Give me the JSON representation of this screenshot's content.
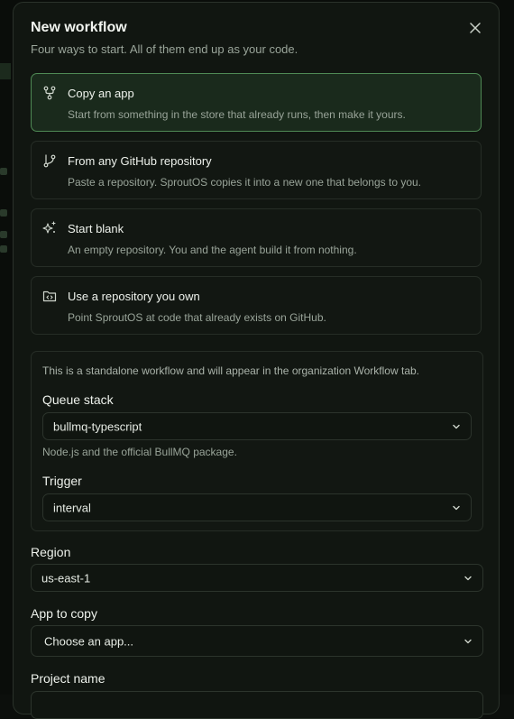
{
  "dialog": {
    "title": "New workflow",
    "subtitle": "Four ways to start. All of them end up as your code."
  },
  "options": [
    {
      "title": "Copy an app",
      "description": "Start from something in the store that already runs, then make it yours.",
      "icon": "fork-icon",
      "selected": true
    },
    {
      "title": "From any GitHub repository",
      "description": "Paste a repository. SproutOS copies it into a new one that belongs to you.",
      "icon": "git-branch-icon",
      "selected": false
    },
    {
      "title": "Start blank",
      "description": "An empty repository. You and the agent build it from nothing.",
      "icon": "sparkles-icon",
      "selected": false
    },
    {
      "title": "Use a repository you own",
      "description": "Point SproutOS at code that already exists on GitHub.",
      "icon": "folder-code-icon",
      "selected": false
    }
  ],
  "workflow_panel": {
    "note": "This is a standalone workflow and will appear in the organization Workflow tab.",
    "queue_stack": {
      "label": "Queue stack",
      "value": "bullmq-typescript",
      "hint": "Node.js and the official BullMQ package."
    },
    "trigger": {
      "label": "Trigger",
      "value": "interval"
    }
  },
  "region": {
    "label": "Region",
    "value": "us-east-1"
  },
  "app_to_copy": {
    "label": "App to copy",
    "value": "Choose an app..."
  },
  "project_name": {
    "label": "Project name"
  },
  "colors": {
    "accent_border": "#4f8a55",
    "selected_bg": "#1a2a1c",
    "dialog_bg": "#111611"
  }
}
